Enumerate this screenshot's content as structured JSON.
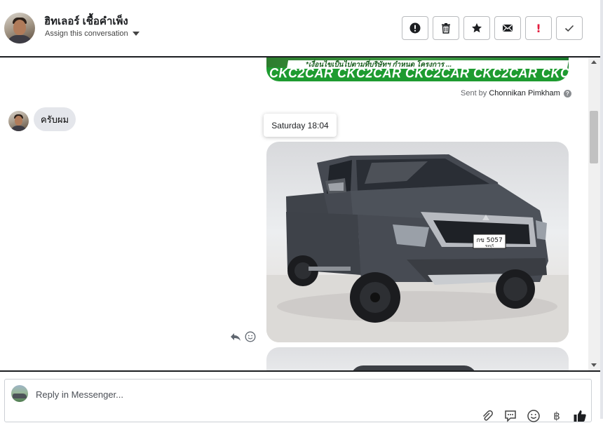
{
  "header": {
    "contact_name": "ฮิทเลอร์ เชื้อคำเพ็ง",
    "assign_label": "Assign this conversation",
    "actions": [
      {
        "name": "spam-button",
        "icon": "alert-circle-icon"
      },
      {
        "name": "delete-button",
        "icon": "trash-icon"
      },
      {
        "name": "star-button",
        "icon": "star-icon"
      },
      {
        "name": "mark-unread-button",
        "icon": "envelope-icon"
      },
      {
        "name": "follow-up-button",
        "icon": "exclamation-icon"
      },
      {
        "name": "mark-done-button",
        "icon": "checkmark-icon"
      }
    ]
  },
  "thread": {
    "banner_thai_text": "*เงื่อนไขเป็นไปตามที่บริษัทฯ กำหนด โครงการ ...",
    "banner_text": "CKC2CAR CKC2CAR CKC2CAR CKC2CAR CKC2",
    "sent_by_prefix": "Sent by",
    "sent_by_name": "Chonnikan Pimkham",
    "incoming_message": "ครับผม",
    "timestamp_tooltip": "Saturday 18:04",
    "image_plate": "กข 5057",
    "image_plate_sub": "ชลบุรี",
    "image_brand_color": "#4a4f57"
  },
  "composer": {
    "placeholder": "Reply in Messenger...",
    "tools": [
      "paperclip-icon",
      "saved-reply-icon",
      "emoji-icon",
      "baht-icon",
      "thumbs-up-icon"
    ],
    "baht_symbol": "฿"
  }
}
